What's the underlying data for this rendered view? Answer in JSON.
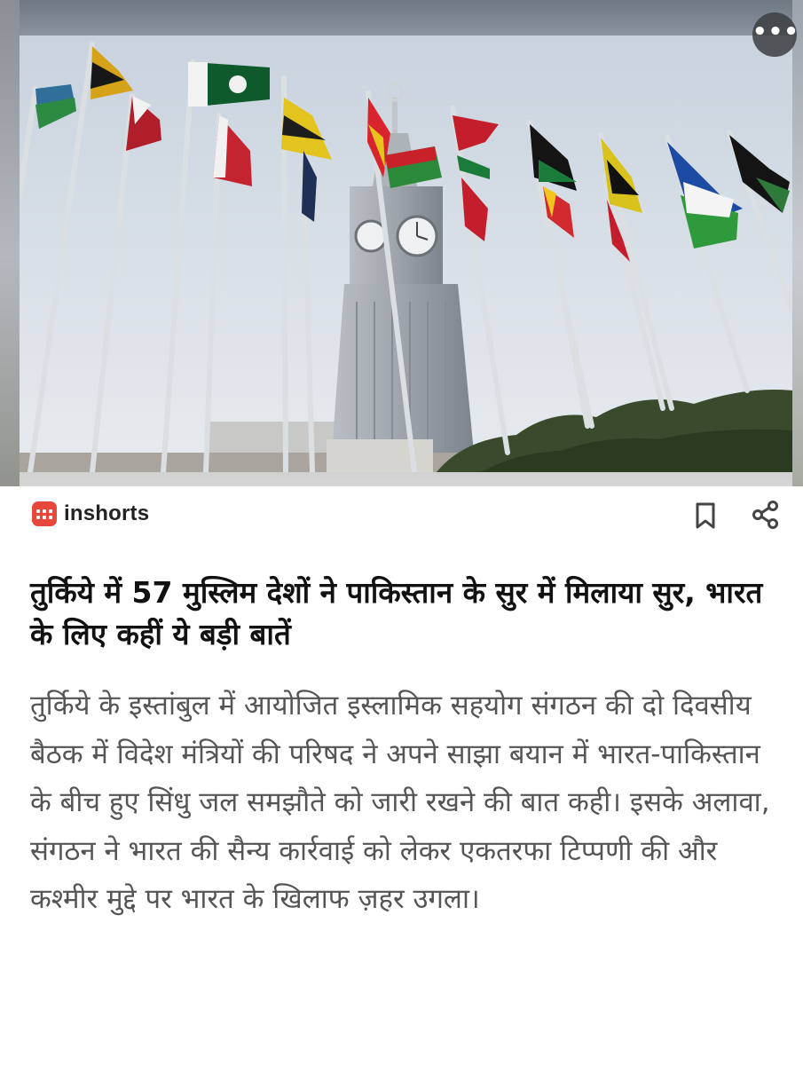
{
  "header": {
    "more_label": "•••"
  },
  "source": {
    "name": "inshorts",
    "accent": "#e8473b"
  },
  "actions": {
    "bookmark_icon": "bookmark-icon",
    "share_icon": "share-icon"
  },
  "article": {
    "headline": "तुर्किये में 57 मुस्लिम देशों ने पाकिस्तान के सुर में मिलाया सुर, भारत के लिए कहीं ये बड़ी बातें",
    "body": "तुर्किये के इस्तांबुल में आयोजित इस्लामिक सहयोग संगठन की दो दिवसीय बैठक में विदेश मंत्रियों की परिषद ने अपने साझा बयान में भारत-पाकिस्तान के बीच हुए सिंधु जल समझौते को जारी रखने की बात कही। इसके अलावा, संगठन ने भारत की सैन्य कार्रवाई को लेकर एकतरफा टिप्पणी की और कश्मीर मुद्दे पर भारत के खिलाफ ज़हर उगला।"
  }
}
